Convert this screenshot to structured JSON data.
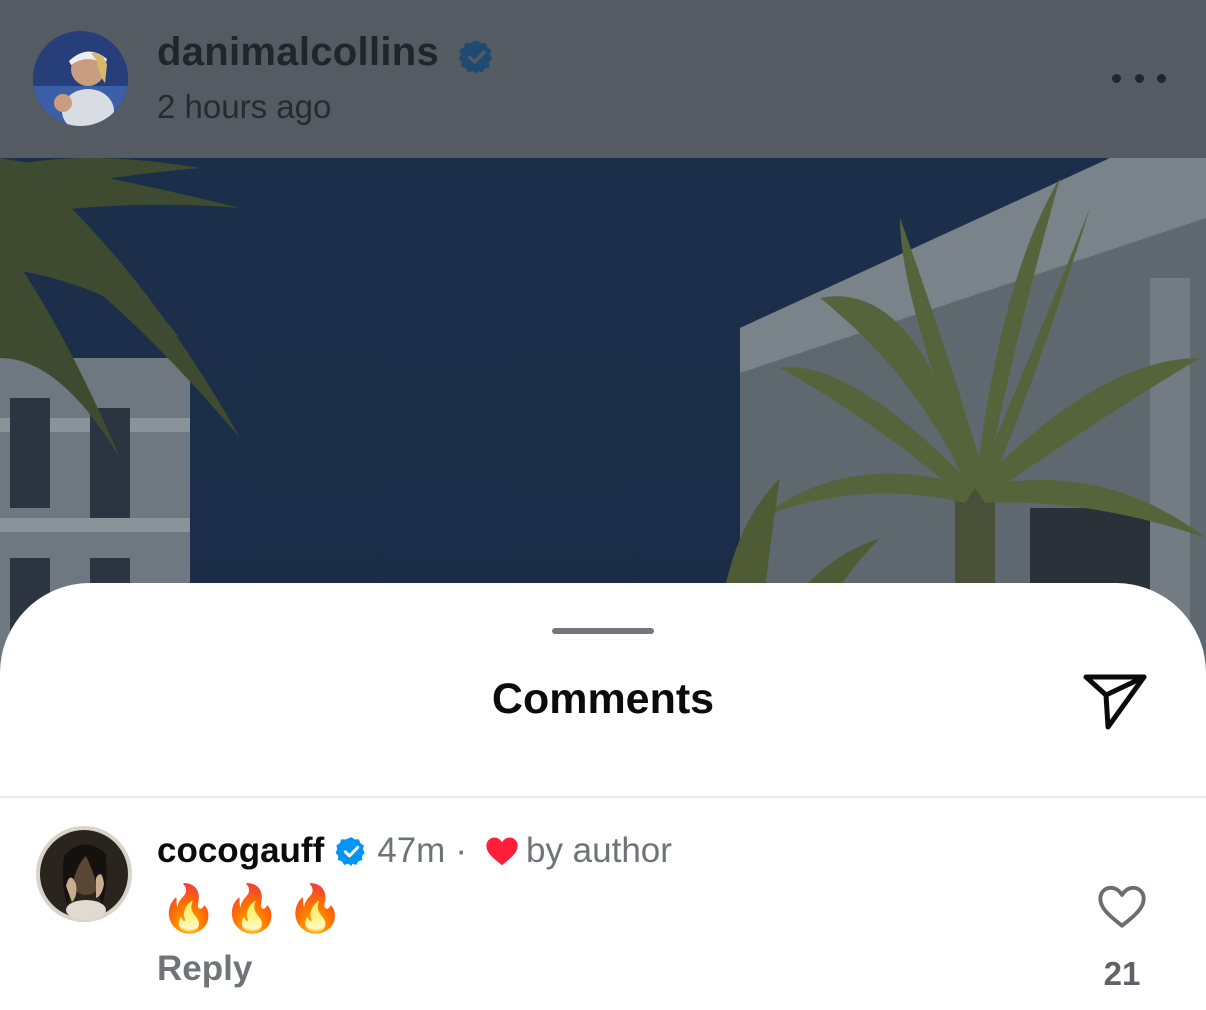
{
  "post": {
    "username": "danimalcollins",
    "verified": true,
    "timestamp": "2 hours ago",
    "more_icon": "more-horizontal-icon"
  },
  "sheet": {
    "title": "Comments",
    "share_icon": "send-icon"
  },
  "comment": {
    "username": "cocogauff",
    "verified": true,
    "time": "47m",
    "separator": "·",
    "liked_by_author_icon": "heart-filled-icon",
    "liked_by_author_label": "by author",
    "text": "🔥🔥🔥",
    "reply_label": "Reply",
    "like_icon": "heart-outline-icon",
    "like_count": "21"
  },
  "colors": {
    "verified_blue": "#0095f6",
    "heart_red": "#ff3040",
    "header_overlay": "#545b62"
  }
}
